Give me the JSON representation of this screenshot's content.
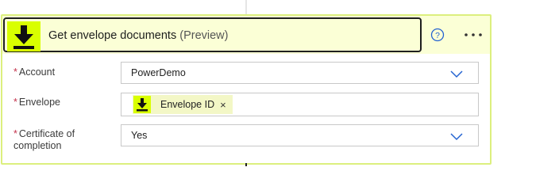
{
  "action": {
    "title": "Get envelope documents",
    "title_suffix": "(Preview)",
    "icon": "download-icon",
    "help_icon": "help-circle-icon",
    "more_icon": "more-options-icon"
  },
  "fields": {
    "account": {
      "required_marker": "*",
      "label": "Account",
      "value": "PowerDemo",
      "icon": "chevron-down-icon"
    },
    "envelope": {
      "required_marker": "*",
      "label": "Envelope",
      "token_label": "Envelope ID",
      "token_close": "×",
      "token_icon": "download-icon"
    },
    "certificate": {
      "required_marker": "*",
      "label_line1": "Certificate of",
      "label_line2": "completion",
      "value": "Yes",
      "icon": "chevron-down-icon"
    }
  },
  "colors": {
    "accent": "#d9ff00",
    "card_border": "#dcef7e",
    "header_bg": "#fbffd6",
    "required": "#c4314b",
    "link_blue": "#2463d1"
  }
}
